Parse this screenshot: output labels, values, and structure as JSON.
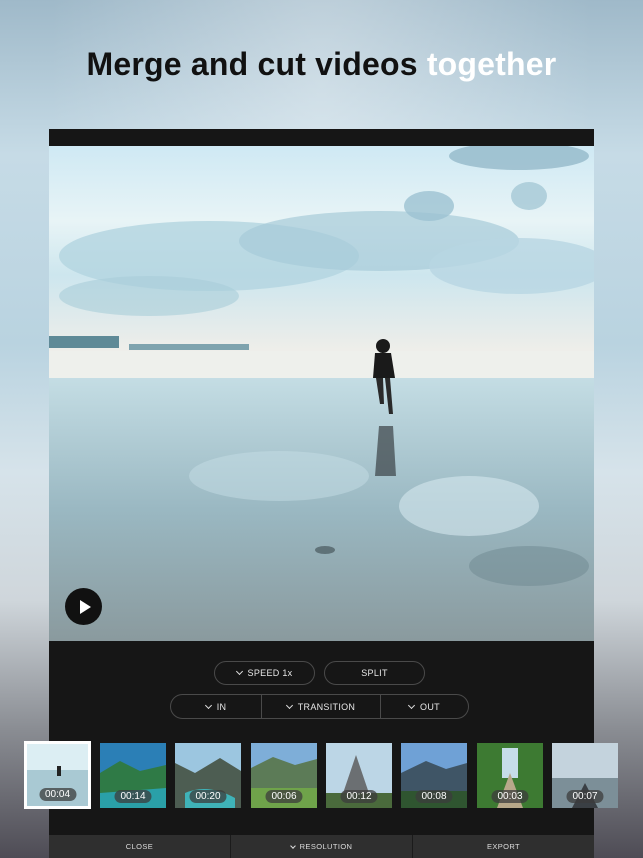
{
  "headline": {
    "part1": "Merge and cut videos",
    "part2": "together"
  },
  "player": {
    "play_icon": "play-icon"
  },
  "controls": {
    "speed_label": "SPEED 1x",
    "split_label": "SPLIT",
    "in_label": "IN",
    "transition_label": "TRANSITION",
    "out_label": "OUT"
  },
  "clips": [
    {
      "duration": "00:04",
      "selected": true
    },
    {
      "duration": "00:14"
    },
    {
      "duration": "00:20"
    },
    {
      "duration": "00:06"
    },
    {
      "duration": "00:12"
    },
    {
      "duration": "00:08"
    },
    {
      "duration": "00:03"
    },
    {
      "duration": "00:07"
    }
  ],
  "bottom_bar": {
    "close_label": "CLOSE",
    "resolution_label": "RESOLUTION",
    "export_label": "EXPORT"
  }
}
